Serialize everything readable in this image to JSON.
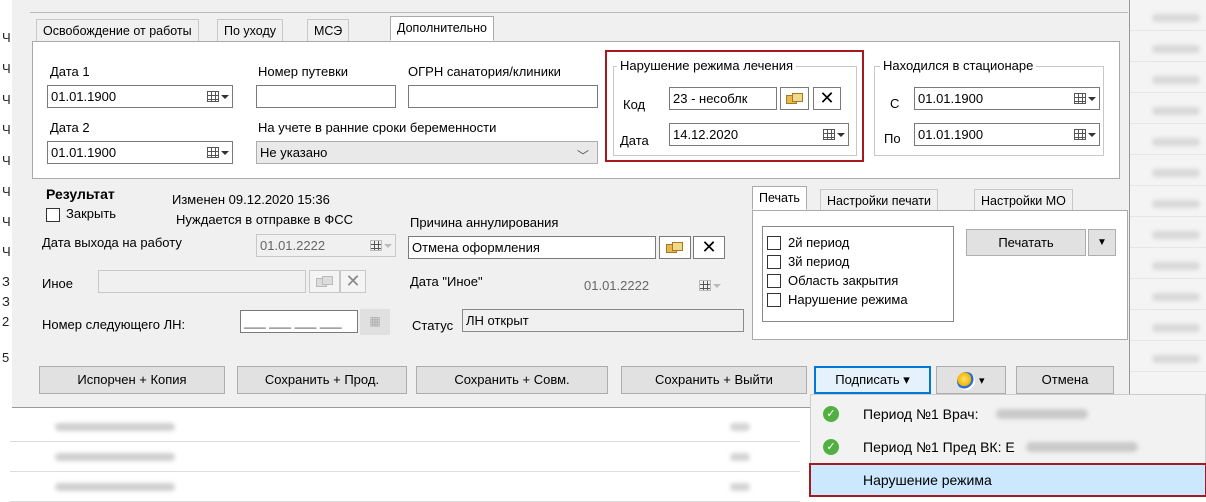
{
  "tabs": [
    "Освобождение от работы",
    "По уходу",
    "МСЭ",
    "Дополнительно"
  ],
  "fields": {
    "date1_label": "Дата 1",
    "date1_value": "01.01.1900",
    "date2_label": "Дата 2",
    "date2_value": "01.01.1900",
    "voucher_label": "Номер путевки",
    "voucher_value": "",
    "ogrn_label": "ОГРН санатория/клиники",
    "ogrn_value": "",
    "pregnancy_label": "На учете в ранние сроки беременности",
    "pregnancy_value": "Не указано"
  },
  "violation": {
    "title": "Нарушение режима лечения",
    "code_label": "Код",
    "code_value": "23 - несоблк",
    "date_label": "Дата",
    "date_value": "14.12.2020"
  },
  "hospital": {
    "title": "Находился в стационаре",
    "from_label": "С",
    "from_value": "01.01.1900",
    "to_label": "По",
    "to_value": "01.01.1900"
  },
  "result": {
    "title": "Результат",
    "changed": "Изменен 09.12.2020 15:36",
    "needs_fss": "Нуждается в отправке в ФСС",
    "close_label": "Закрыть",
    "return_label": "Дата выхода на работу",
    "return_value": "01.01.2222",
    "other_label": "Иное",
    "other_value": "",
    "next_ln_label": "Номер следующего ЛН:",
    "next_ln_value": "___ ___ ___ ___",
    "cancel_reason_label": "Причина аннулирования",
    "cancel_reason_value": "Отмена оформления",
    "other_date_label": "Дата \"Иное\"",
    "other_date_value": "01.01.2222",
    "status_label": "Статус",
    "status_value": "ЛН открыт"
  },
  "print_tabs": [
    "Печать",
    "Настройки печати",
    "Настройки МО"
  ],
  "print_options": [
    "2й период",
    "3й период",
    "Область закрытия",
    "Нарушение режима"
  ],
  "print_button": "Печатать",
  "print_arrow": "▼",
  "bottom_buttons": {
    "spoiled": "Испорчен + Копия",
    "save_next": "Сохранить + Прод.",
    "save_combined": "Сохранить + Совм.",
    "save_exit": "Сохранить + Выйти",
    "sign": "Подписать ▾",
    "ecp": "▾",
    "cancel": "Отмена"
  },
  "sign_menu": [
    {
      "label": "Период №1 Врач:",
      "checked": true
    },
    {
      "label": "Период №1 Пред ВК: Е",
      "checked": true
    },
    {
      "label": "Нарушение режима",
      "checked": false
    }
  ],
  "left_markers": [
    "Ч",
    "Ч",
    "Ч",
    "Ч",
    "Ч",
    "Ч",
    "Ч",
    "Ч",
    "З",
    "З",
    "2",
    "5"
  ],
  "icons": {
    "calendar": "calendar-dropdown-icon",
    "picker": "folder-picker-icon",
    "clear": "✕",
    "check": "✓",
    "ecp": "signature-ecp-icon"
  }
}
